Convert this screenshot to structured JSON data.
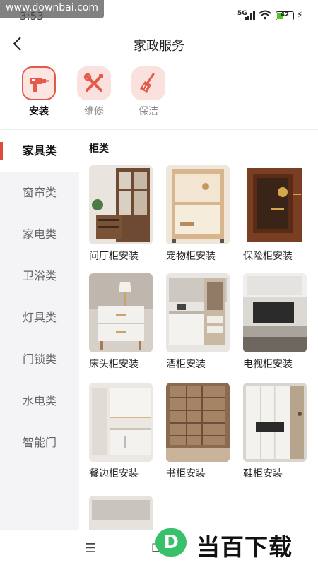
{
  "status_bar": {
    "time": "3:53",
    "watermark": "www.downbai.com",
    "network": "5G",
    "battery": "42"
  },
  "header": {
    "title": "家政服务"
  },
  "top_tabs": [
    {
      "label": "安装",
      "icon": "drill-icon",
      "active": true
    },
    {
      "label": "维修",
      "icon": "wrench-screwdriver-icon",
      "active": false
    },
    {
      "label": "保洁",
      "icon": "broom-icon",
      "active": false
    }
  ],
  "sidebar": {
    "items": [
      {
        "label": "家具类",
        "active": true
      },
      {
        "label": "窗帘类"
      },
      {
        "label": "家电类"
      },
      {
        "label": "卫浴类"
      },
      {
        "label": "灯具类"
      },
      {
        "label": "门锁类"
      },
      {
        "label": "水电类"
      },
      {
        "label": "智能门"
      }
    ]
  },
  "content": {
    "category_title": "柜类",
    "items": [
      {
        "label": "间厅柜安装"
      },
      {
        "label": "宠物柜安装"
      },
      {
        "label": "保险柜安装"
      },
      {
        "label": "床头柜安装"
      },
      {
        "label": "酒柜安装"
      },
      {
        "label": "电视柜安装"
      },
      {
        "label": "餐边柜安装"
      },
      {
        "label": "书柜安装"
      },
      {
        "label": "鞋柜安装"
      }
    ]
  },
  "bottom_nav": {
    "menu_icon": "☰",
    "home_icon": "◻"
  },
  "logo": {
    "text": "当百下载",
    "letter": "D"
  },
  "colors": {
    "accent": "#e04a3a",
    "tab_bg": "#fbe1dd",
    "sidebar_bg": "#f4f4f6",
    "logo_green": "#39c06a"
  }
}
